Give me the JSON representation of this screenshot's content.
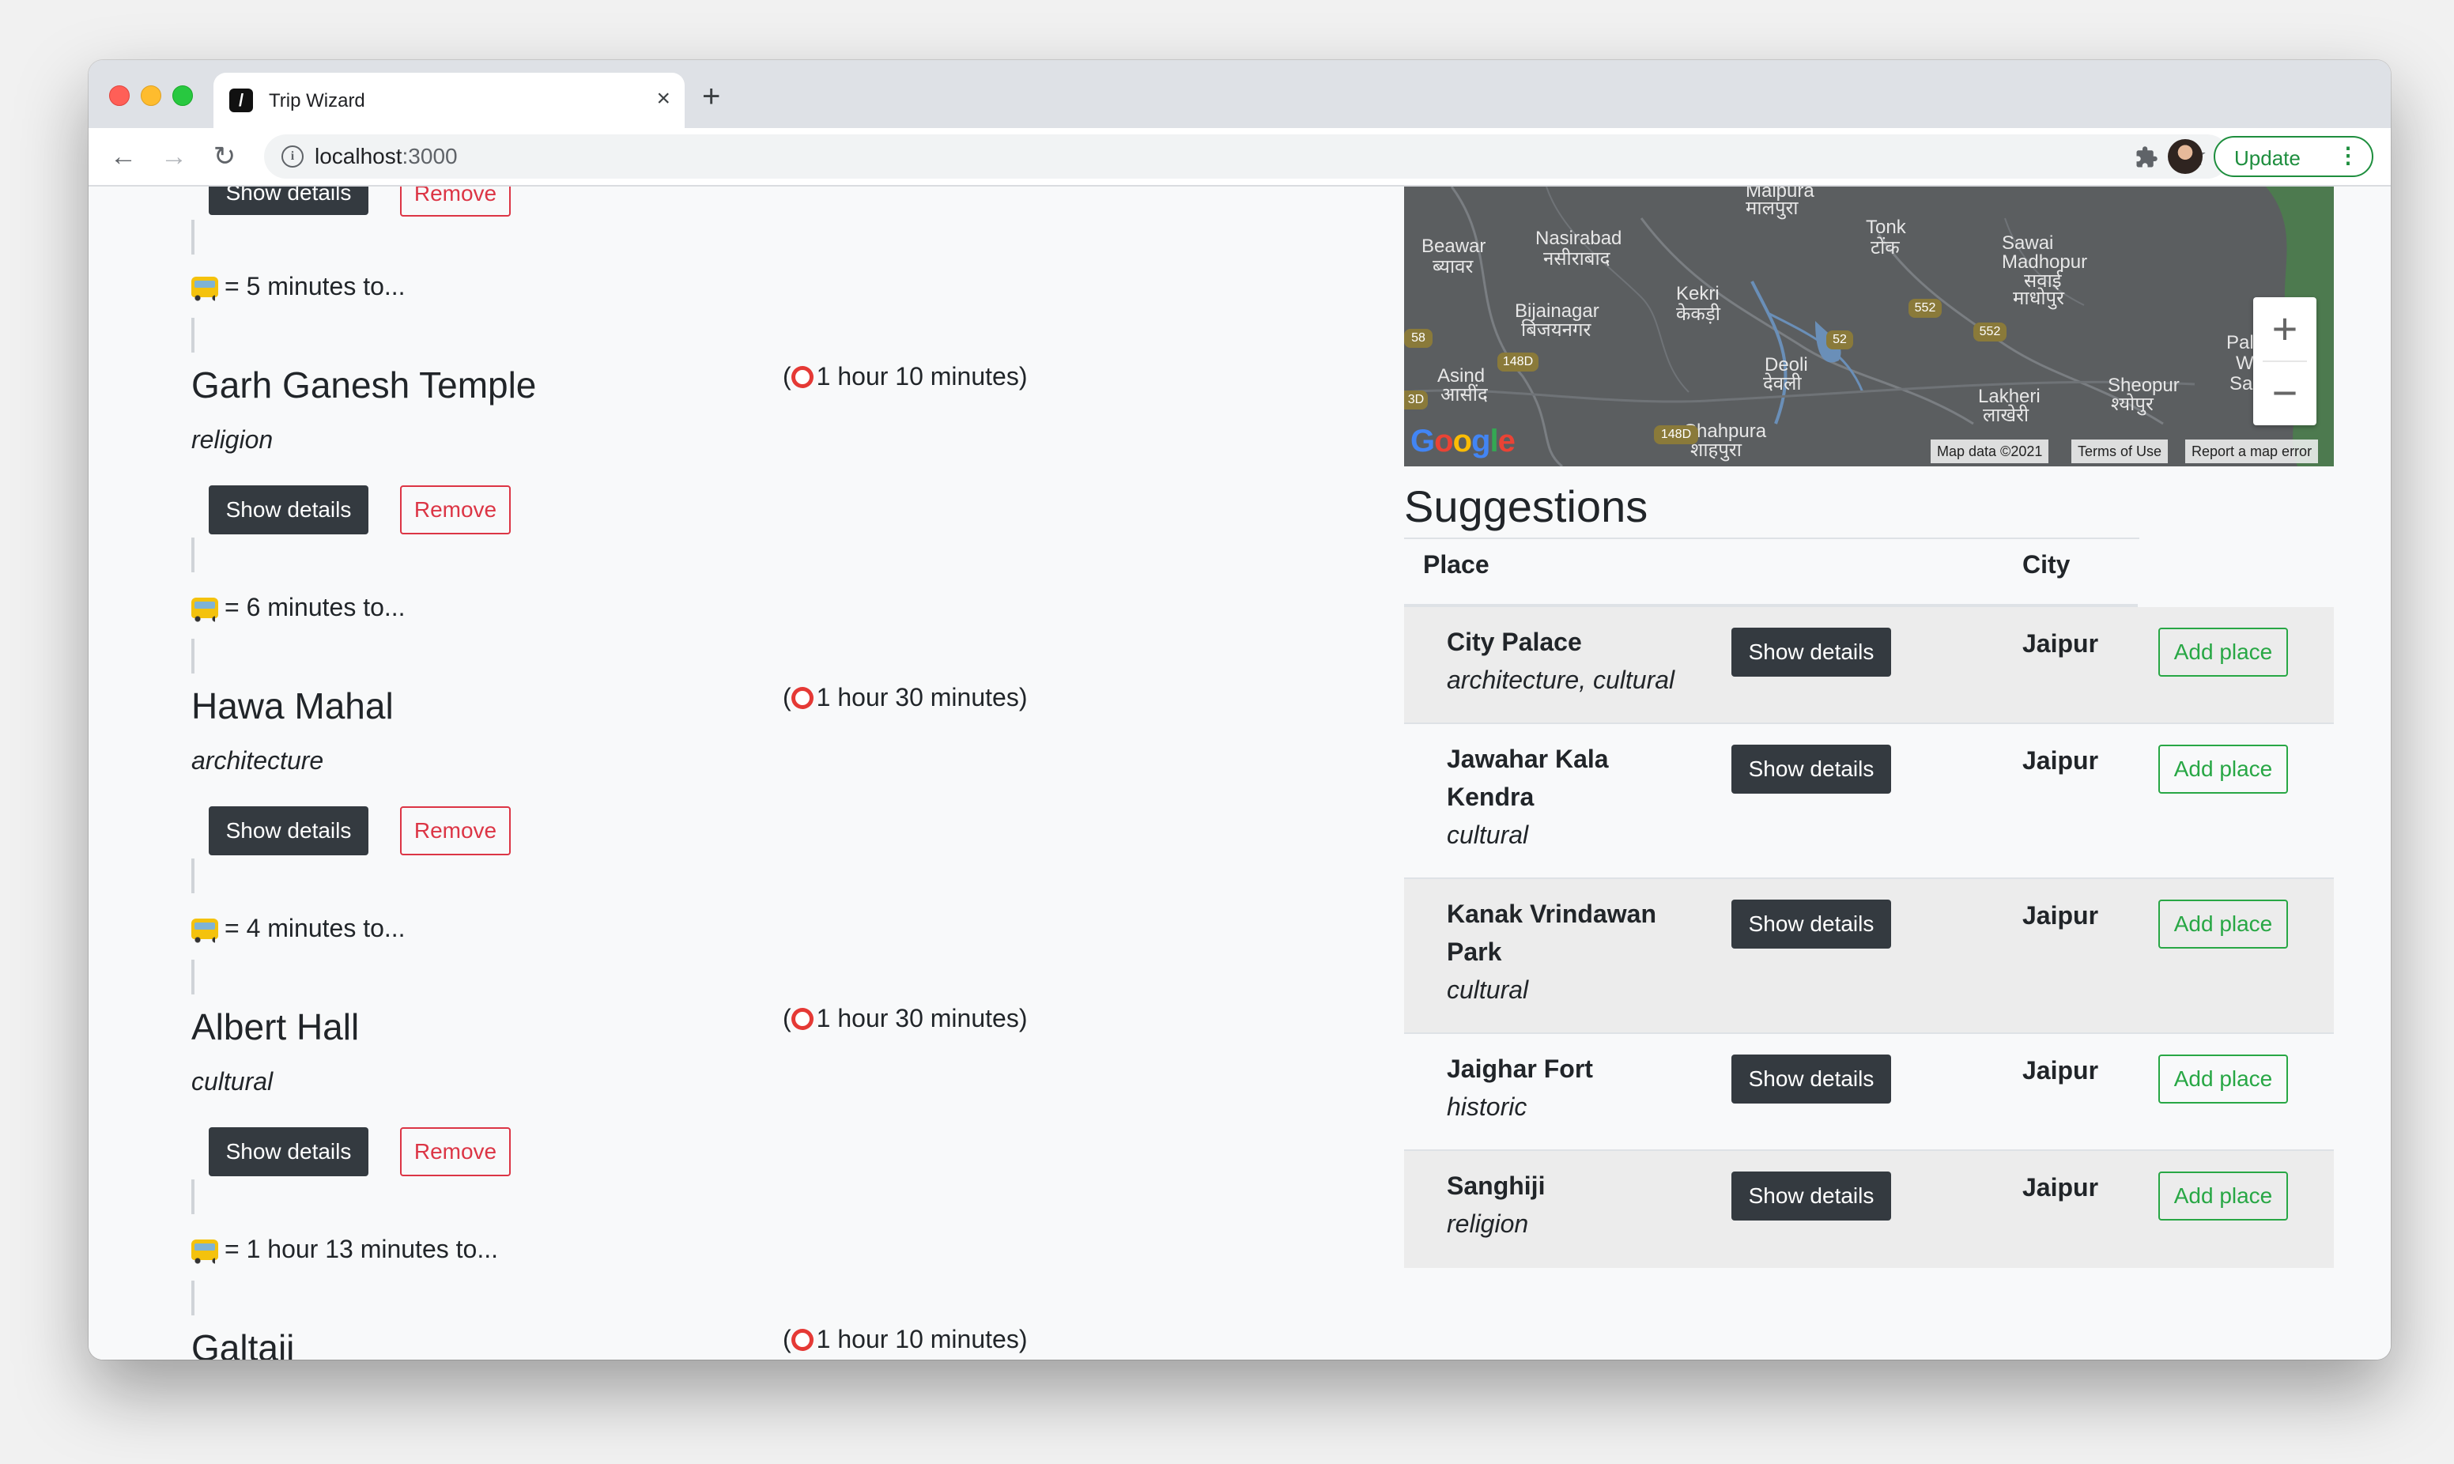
{
  "browser": {
    "tab_title": "Trip Wizard",
    "tab_close": "×",
    "new_tab": "+",
    "url_host": "localhost",
    "url_port": ":3000",
    "update_label": "Update",
    "menu_dots": "⋮",
    "back_icon": "←",
    "forward_icon": "→",
    "reload_icon": "↻",
    "star_icon": "☆"
  },
  "itinerary": {
    "show_details_label": "Show details",
    "remove_label": "Remove",
    "top_travel": "= 5 minutes to...",
    "places": [
      {
        "name": "Garh Ganesh Temple",
        "category": "religion",
        "duration": "1 hour 10 minutes)",
        "travel_after": "= 6 minutes to..."
      },
      {
        "name": "Hawa Mahal",
        "category": "architecture",
        "duration": "1 hour 30 minutes)",
        "travel_after": "= 4 minutes to..."
      },
      {
        "name": "Albert Hall",
        "category": "cultural",
        "duration": "1 hour 30 minutes)",
        "travel_after": "= 1 hour 13 minutes to..."
      },
      {
        "name": "Galtaji",
        "category": "",
        "duration": "1 hour 10 minutes)",
        "travel_after": ""
      }
    ],
    "duration_open_paren": "("
  },
  "map": {
    "zoom_in": "+",
    "zoom_out": "−",
    "map_data": "Map data ©2021",
    "terms": "Terms of Use",
    "report": "Report a map error",
    "google_logo": "Google",
    "labels": [
      "Beawar",
      "ब्यावर",
      "Nasirabad",
      "नसीराबाद",
      "Tonk",
      "टोंक",
      "Sawai",
      "Madhopur",
      "सवाई",
      "माधोपुर",
      "Kekri",
      "केकड़ी",
      "Bijainagar",
      "बिजयनगर",
      "Asind",
      "आसींद",
      "Deoli",
      "देवली",
      "Lakheri",
      "लाखेरी",
      "Sheopur",
      "श्योपुर",
      "Shahpura",
      "शाहपुरा",
      "Malpura",
      "मालपुरा",
      "Palp",
      "Wi",
      "San"
    ],
    "roads": [
      "58",
      "148D",
      "552",
      "552",
      "52",
      "148D",
      "3D"
    ]
  },
  "suggestions": {
    "title": "Suggestions",
    "col_place": "Place",
    "col_city": "City",
    "show_details_label": "Show details",
    "add_label": "Add place",
    "rows": [
      {
        "name_line1": "City Palace",
        "name_line2": "",
        "category": "architecture, cultural",
        "city": "Jaipur"
      },
      {
        "name_line1": "Jawahar Kala",
        "name_line2": "Kendra",
        "category": "cultural",
        "city": "Jaipur"
      },
      {
        "name_line1": "Kanak Vrindawan",
        "name_line2": "Park",
        "category": "cultural",
        "city": "Jaipur"
      },
      {
        "name_line1": "Jaighar Fort",
        "name_line2": "",
        "category": "historic",
        "city": "Jaipur"
      },
      {
        "name_line1": "Sanghiji",
        "name_line2": "",
        "category": "religion",
        "city": "Jaipur"
      }
    ]
  }
}
